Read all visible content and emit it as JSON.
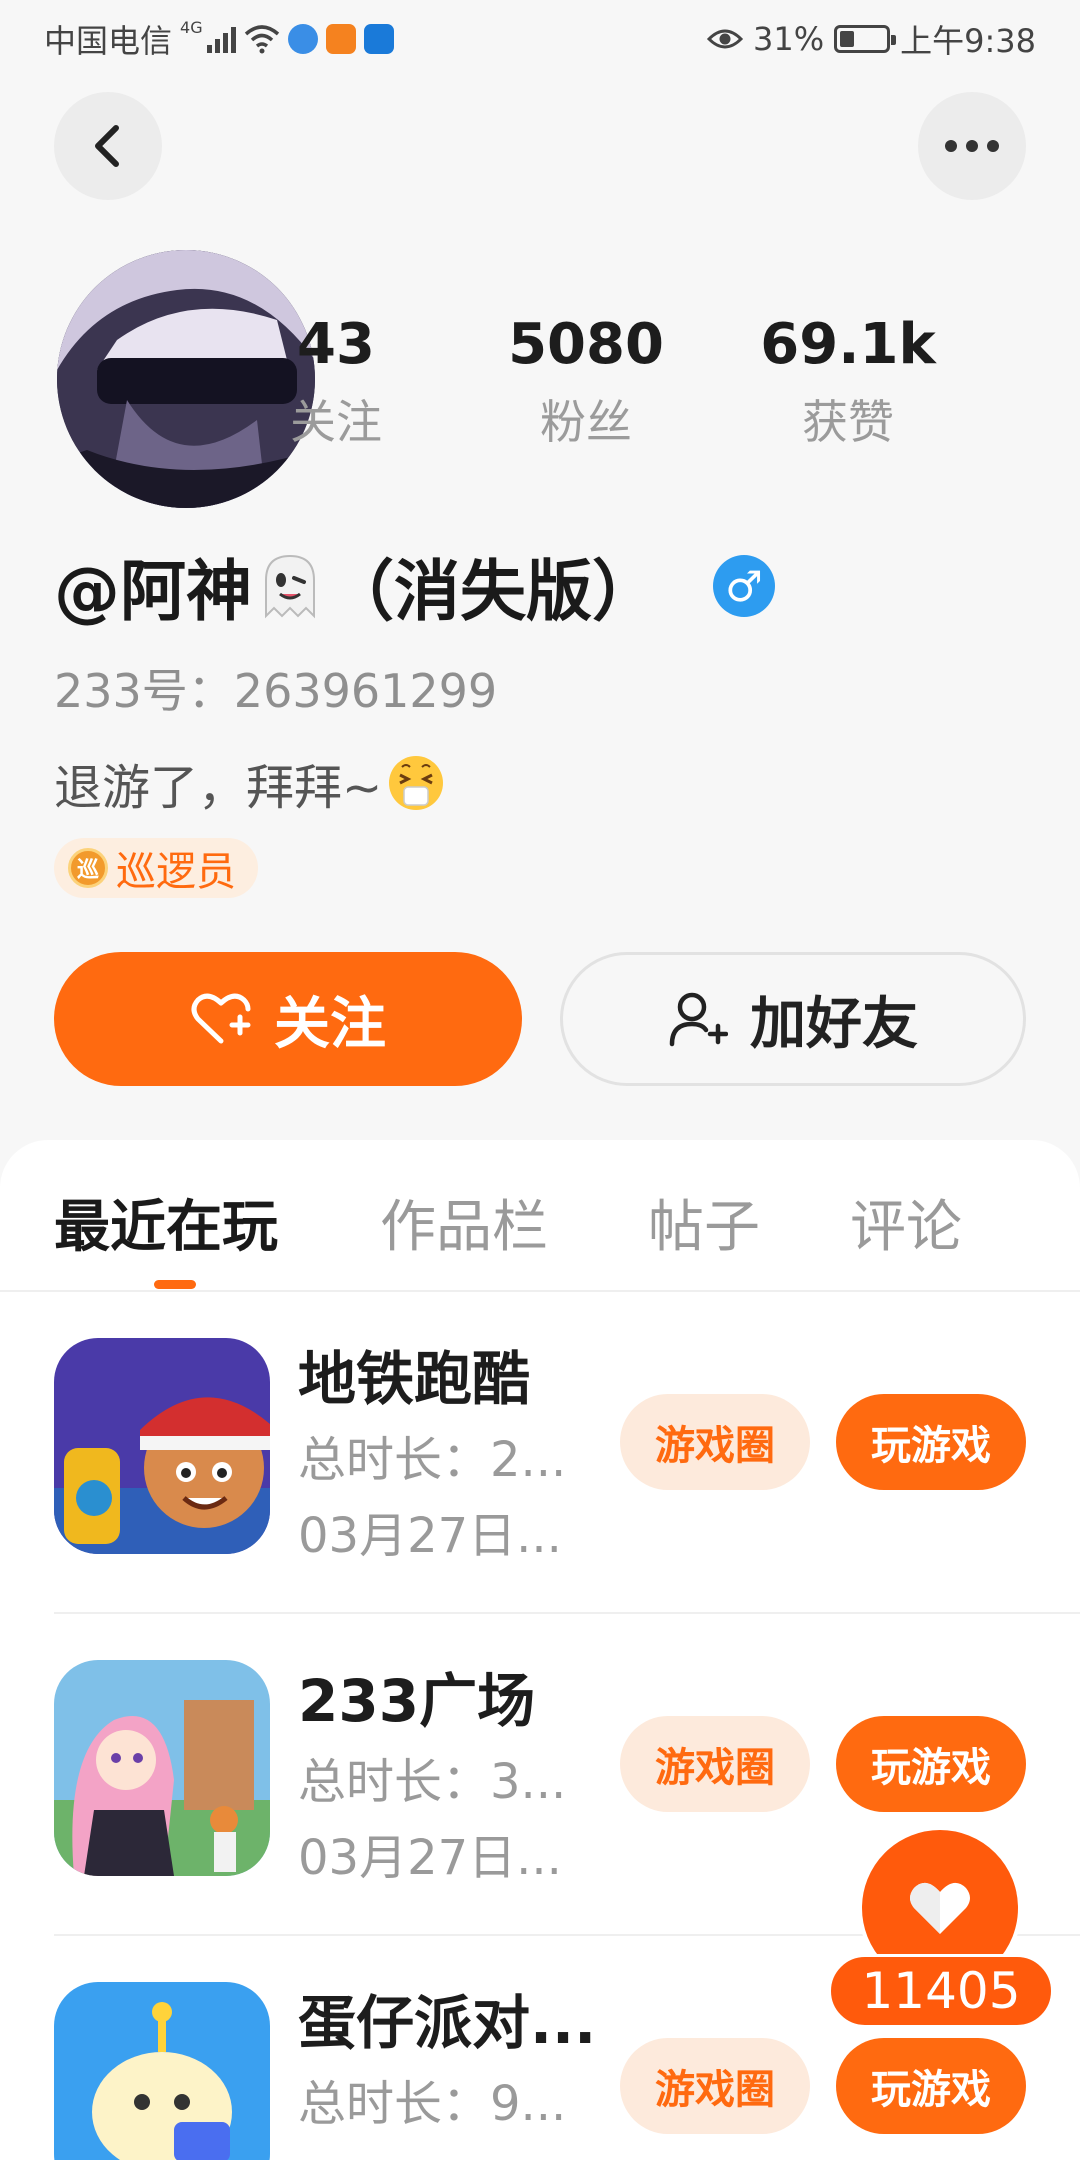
{
  "status_bar": {
    "carrier": "中国电信",
    "network": "4G",
    "battery": "31%",
    "battery_level": 0.31,
    "time": "上午9:38"
  },
  "icons": {
    "back": "back-arrow-icon",
    "more": "more-dots-icon",
    "follow": "heart-plus-icon",
    "add_friend": "person-plus-icon",
    "like": "heart-icon"
  },
  "profile": {
    "stats": [
      {
        "value": "43",
        "label": "关注"
      },
      {
        "value": "5080",
        "label": "粉丝"
      },
      {
        "value": "69.1k",
        "label": "获赞"
      }
    ],
    "name_prefix": "@阿神",
    "name_suffix": "（消失版）",
    "gender": "♂",
    "uid": "233号：263961299",
    "bio": "退游了，拜拜~",
    "role_tag": {
      "icon_text": "巡",
      "label": "巡逻员"
    }
  },
  "actions": {
    "follow_label": "关注",
    "add_friend_label": "加好友"
  },
  "tabs": [
    "最近在玩",
    "作品栏",
    "帖子",
    "评论"
  ],
  "games": [
    {
      "name": "地铁跑酷",
      "duration": "总时长：2...",
      "date": "03月27日...",
      "circle_label": "游戏圈",
      "play_label": "玩游戏"
    },
    {
      "name": "233广场",
      "duration": "总时长：3...",
      "date": "03月27日...",
      "circle_label": "游戏圈",
      "play_label": "玩游戏"
    },
    {
      "name": "蛋仔派对...",
      "duration": "总时长：9...",
      "date": "",
      "circle_label": "游戏圈",
      "play_label": "玩游戏"
    }
  ],
  "like_fab": {
    "count": "11405"
  },
  "colors": {
    "accent": "#ff6a10",
    "gender_blue": "#2d9cf0",
    "tag_bg": "#fdeadc"
  }
}
